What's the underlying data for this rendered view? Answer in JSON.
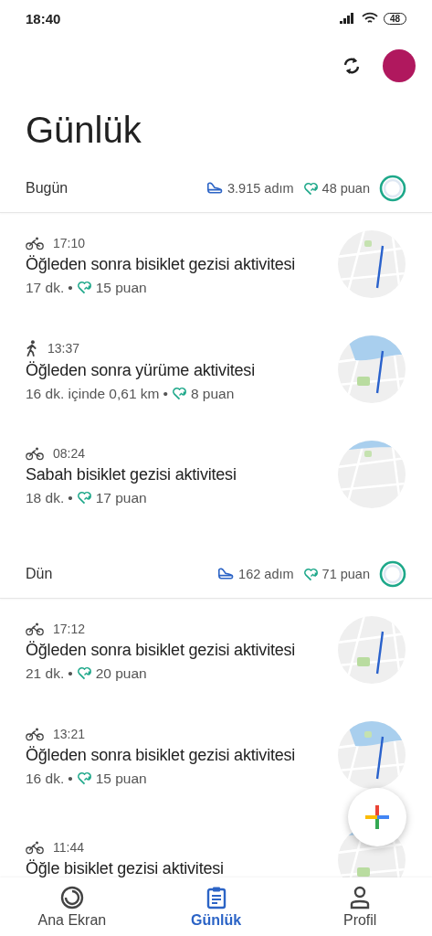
{
  "status_bar": {
    "time": "18:40",
    "battery": "48"
  },
  "header": {
    "title": "Günlük"
  },
  "days": [
    {
      "label": "Bugün",
      "steps": "3.915 adım",
      "points": "48 puan",
      "activities": [
        {
          "kind": "bike",
          "time": "17:10",
          "title": "Öğleden sonra bisiklet gezisi aktivitesi",
          "summary": "17 dk.",
          "separator": "•",
          "points": "15 puan"
        },
        {
          "kind": "walk",
          "time": "13:37",
          "title": "Öğleden sonra yürüme aktivitesi",
          "summary": "16 dk. içinde 0,61 km",
          "separator": "•",
          "points": "8 puan"
        },
        {
          "kind": "bike",
          "time": "08:24",
          "title": "Sabah bisiklet gezisi aktivitesi",
          "summary": "18 dk.",
          "separator": "•",
          "points": "17 puan"
        }
      ]
    },
    {
      "label": "Dün",
      "steps": "162 adım",
      "points": "71 puan",
      "activities": [
        {
          "kind": "bike",
          "time": "17:12",
          "title": "Öğleden sonra bisiklet gezisi aktivitesi",
          "summary": "21 dk.",
          "separator": "•",
          "points": "20 puan"
        },
        {
          "kind": "bike",
          "time": "13:21",
          "title": "Öğleden sonra bisiklet gezisi aktivitesi",
          "summary": "16 dk.",
          "separator": "•",
          "points": "15 puan"
        },
        {
          "kind": "bike",
          "time": "11:44",
          "title": "Öğle bisiklet gezisi aktivitesi"
        }
      ]
    }
  ],
  "nav": [
    {
      "kind": "home",
      "label": "Ana Ekran",
      "selected": false
    },
    {
      "kind": "journal",
      "label": "Günlük",
      "selected": true
    },
    {
      "kind": "profile",
      "label": "Profil",
      "selected": false
    }
  ]
}
